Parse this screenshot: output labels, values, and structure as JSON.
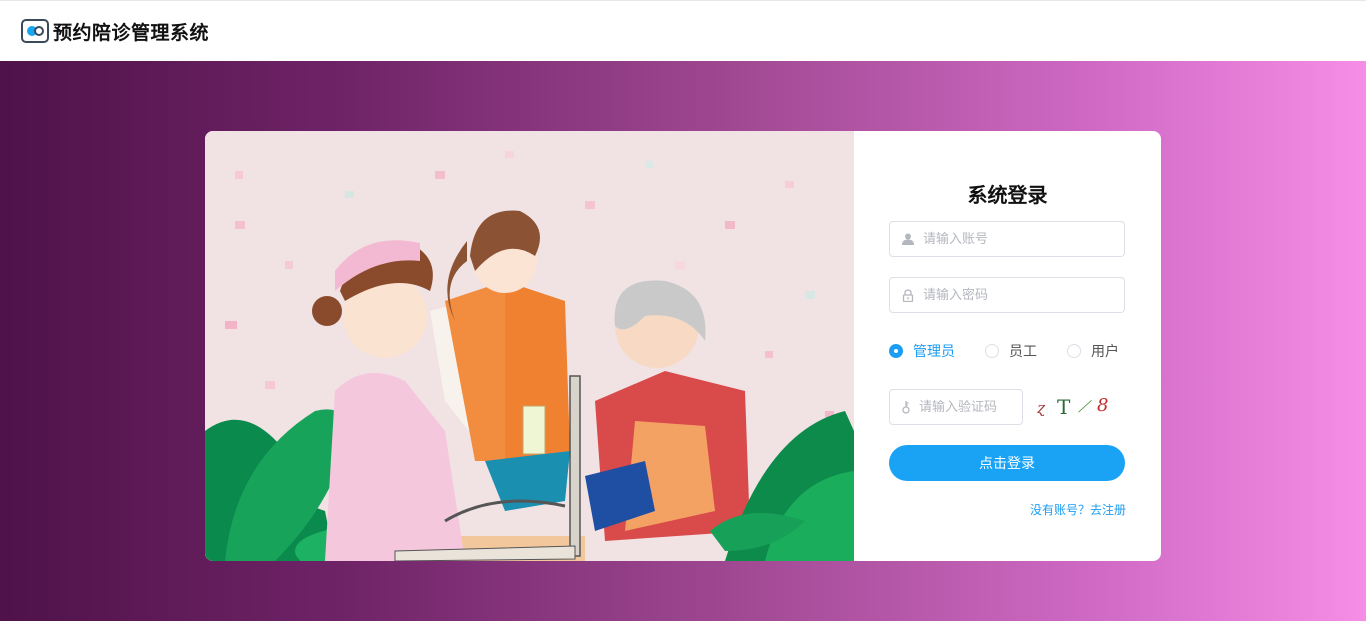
{
  "header": {
    "app_title": "预约陪诊管理系统",
    "logo_icon": "camera-toggle-logo"
  },
  "login": {
    "title": "系统登录",
    "username_placeholder": "请输入账号",
    "password_placeholder": "请输入密码",
    "roles": [
      {
        "label": "管理员",
        "selected": true
      },
      {
        "label": "员工",
        "selected": false
      },
      {
        "label": "用户",
        "selected": false
      }
    ],
    "captcha_placeholder": "请输入验证码",
    "captcha_chars": [
      "ɀ",
      "T",
      "⟋",
      "8"
    ],
    "submit_label": "点击登录",
    "register_link": "没有账号？去注册"
  },
  "colors": {
    "accent": "#1aa3f5",
    "bg_start": "#4f1249",
    "bg_end": "#f68de6"
  }
}
